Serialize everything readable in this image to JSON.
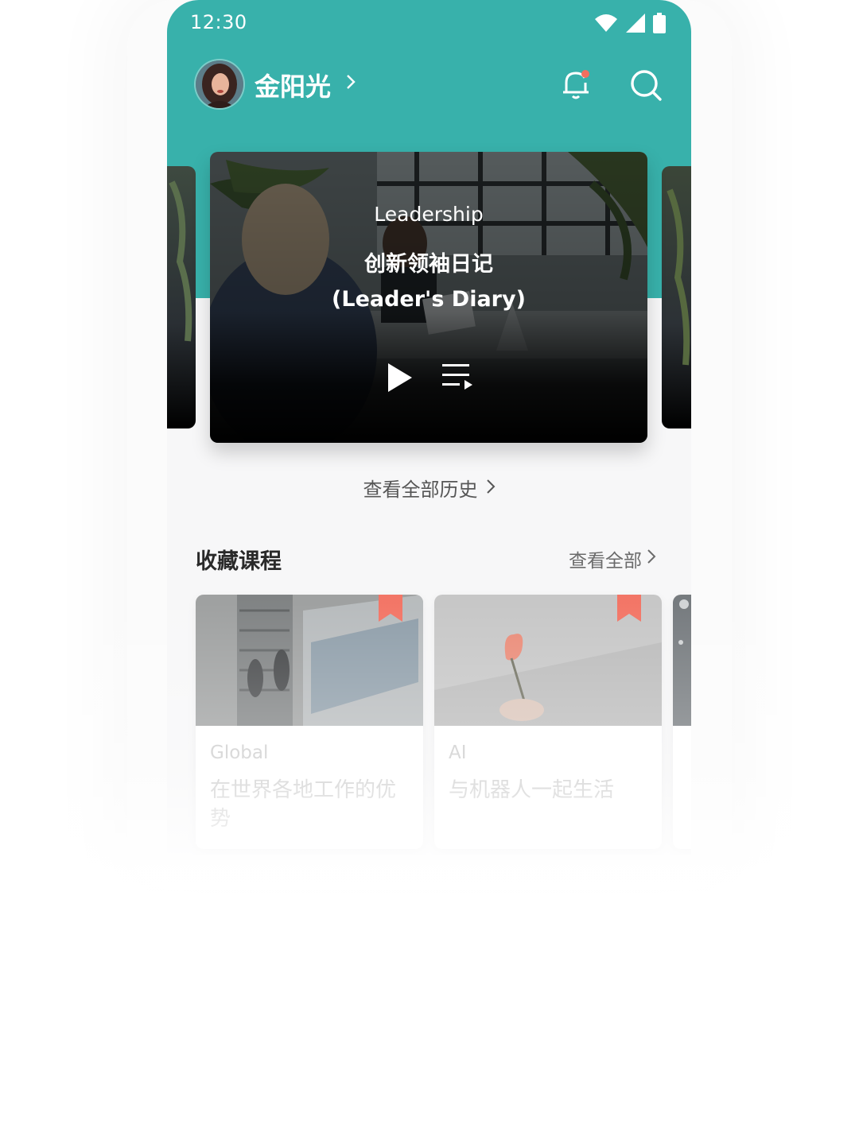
{
  "status_bar": {
    "time": "12:30",
    "icons": [
      "wifi-icon",
      "cellular-icon",
      "battery-icon"
    ]
  },
  "header": {
    "user_name": "金阳光",
    "icons": [
      "bell-icon",
      "search-icon"
    ],
    "has_notification": true
  },
  "featured_course": {
    "category": "Leadership",
    "title_line1": "创新领袖日记",
    "title_line2": "(Leader's Diary)"
  },
  "history_link": {
    "label": "查看全部历史"
  },
  "favorites": {
    "title": "收藏课程",
    "view_all": "查看全部",
    "courses": [
      {
        "category": "Global",
        "title": "在世界各地工作的优势"
      },
      {
        "category": "AI",
        "title": "与机器人一起生活"
      }
    ]
  },
  "colors": {
    "brand_teal": "#38b1ab",
    "bookmark": "#f26f5f",
    "notification_dot": "#f26f5f"
  }
}
